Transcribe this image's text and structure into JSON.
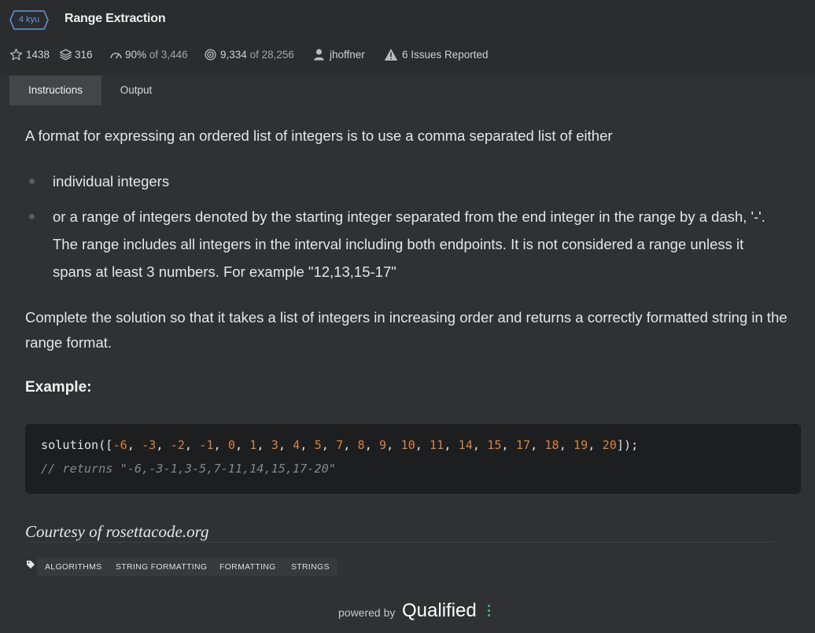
{
  "header": {
    "rank": "4 kyu",
    "title": "Range Extraction"
  },
  "stats": {
    "stars": "1438",
    "collections": "316",
    "satisfaction_pct": "90%",
    "satisfaction_of": "of 3,446",
    "completed": "9,334",
    "completed_of": "of 28,256",
    "author": "jhoffner",
    "issues": "6 Issues Reported"
  },
  "tabs": [
    {
      "label": "Instructions",
      "active": true
    },
    {
      "label": "Output",
      "active": false
    }
  ],
  "description": {
    "intro": "A format for expressing an ordered list of integers is to use a comma separated list of either",
    "bullets": [
      "individual integers",
      "or a range of integers denoted by the starting integer separated from the end integer in the range by a dash, '-'.",
      "The range includes all integers in the interval including both endpoints. It is not considered a range unless it",
      "spans at least 3 numbers. For example \"12,13,15-17\""
    ],
    "task": "Complete the solution so that it takes a list of integers in increasing order and returns a correctly formatted string in the range format.",
    "example_heading": "Example:",
    "code": {
      "fn": "solution",
      "numbers": [
        "-6",
        "-3",
        "-2",
        "-1",
        "0",
        "1",
        "3",
        "4",
        "5",
        "7",
        "8",
        "9",
        "10",
        "11",
        "14",
        "15",
        "17",
        "18",
        "19",
        "20"
      ],
      "comment": "// returns \"-6,-3-1,3-5,7-11,14,15,17-20\""
    },
    "courtesy": "Courtesy of rosettacode.org"
  },
  "tags": [
    "ALGORITHMS",
    "STRING FORMATTING",
    "FORMATTING",
    "STRINGS"
  ],
  "footer": {
    "powered_by": "powered by",
    "brand": "Qualified"
  },
  "colors": {
    "background": "#303133",
    "header_bg": "#2b2c2e",
    "rank_blue": "#6795de",
    "code_number": "#d9823b",
    "brand_dot": "#3ec17c"
  },
  "icons": [
    "star-icon",
    "collection-icon",
    "satisfaction-icon",
    "completed-icon",
    "author-icon",
    "warning-icon",
    "tag-icon"
  ]
}
